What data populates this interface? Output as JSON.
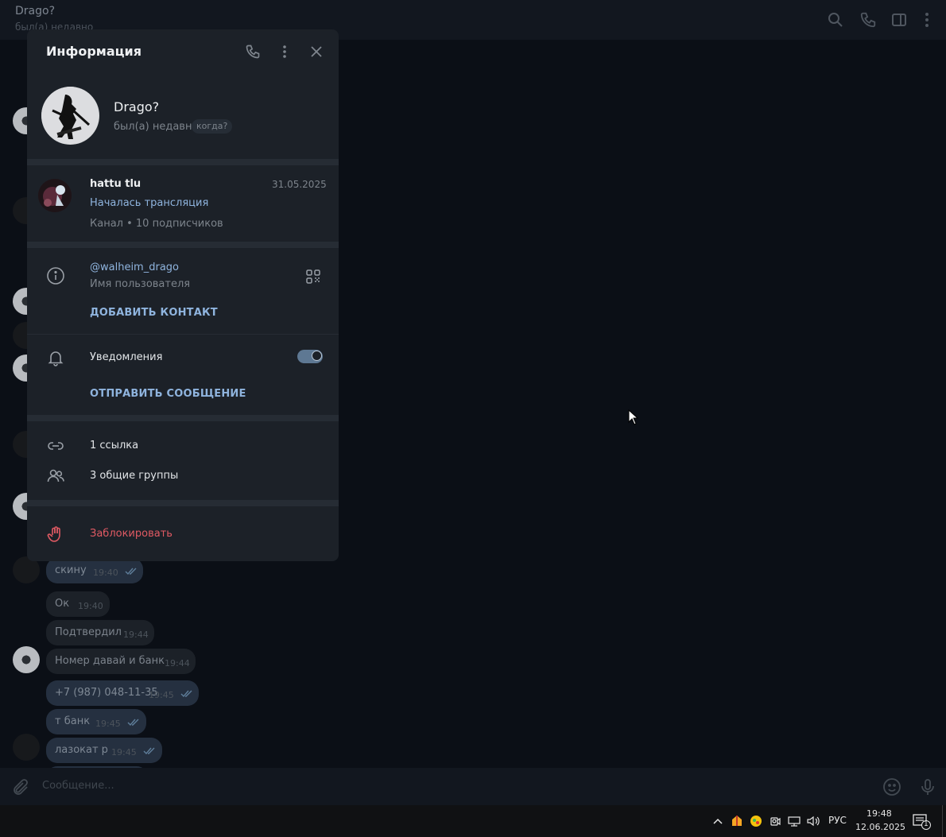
{
  "header": {
    "title": "Drago?",
    "status": "был(а) недавно"
  },
  "chat": {
    "messages": [
      {
        "text": "скину",
        "time": "19:40",
        "outgoing": true,
        "read": true
      },
      {
        "text": "Ок",
        "time": "19:40",
        "outgoing": false
      },
      {
        "text": "Подтвердил",
        "time": "19:44",
        "outgoing": false
      },
      {
        "text": "Номер давай и банк",
        "time": "19:44",
        "outgoing": false
      },
      {
        "text": "+7 (987) 048-11-35",
        "time": "19:45",
        "outgoing": true,
        "read": true
      },
      {
        "text": "т банк",
        "time": "19:45",
        "outgoing": true,
        "read": true
      },
      {
        "text": "лазокат р",
        "time": "19:45",
        "outgoing": true,
        "read": true
      }
    ]
  },
  "input": {
    "placeholder": "Сообщение..."
  },
  "info_panel": {
    "title": "Информация",
    "name": "Drago?",
    "status": "был(а) недавно",
    "when_chip": "когда?",
    "channel": {
      "name": "hattu tlu",
      "date": "31.05.2025",
      "last_message": "Началась трансляция",
      "subtitle": "Канал • 10 подписчиков"
    },
    "username": "@walheim_drago",
    "username_label": "Имя пользователя",
    "add_contact": "ДОБАВИТЬ КОНТАКТ",
    "notifications_label": "Уведомления",
    "notifications_on": true,
    "send_message": "ОТПРАВИТЬ СООБЩЕНИЕ",
    "links": "1 ссылка",
    "groups": "3 общие группы",
    "block": "Заблокировать",
    "colors": {
      "accent": "#8fb4de",
      "danger": "#e05a63",
      "panel_bg": "#1c2128"
    }
  },
  "taskbar": {
    "language": "РУС",
    "time": "19:48",
    "date": "12.06.2025",
    "notification_count": "1"
  }
}
